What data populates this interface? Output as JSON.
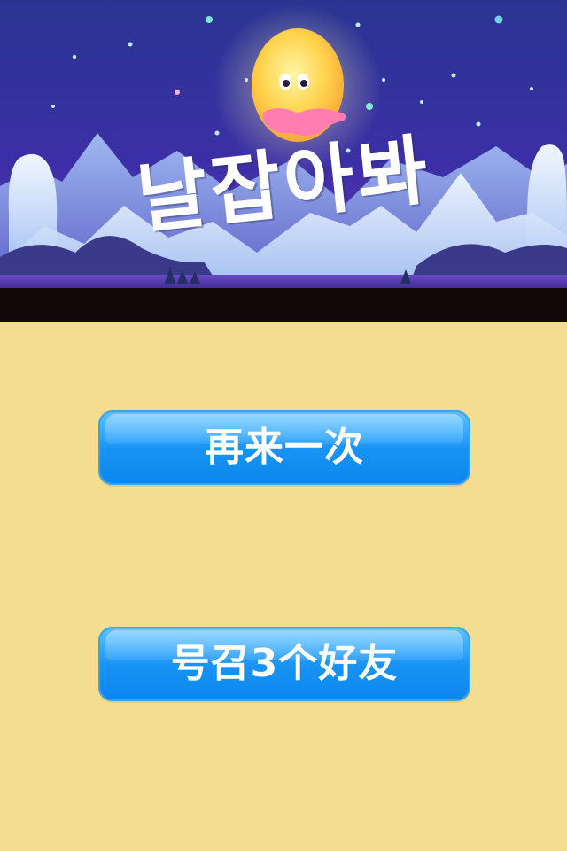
{
  "banner": {
    "title": "날잡아봐"
  },
  "buttons": {
    "retry_label": "再来一次",
    "invite_label": "号召3个好友"
  },
  "colors": {
    "background": "#f2dd90",
    "button": "#1793f4",
    "sky_top": "#2a3592",
    "sky_bottom": "#5a2fb0",
    "moon": "#ffd24a"
  }
}
